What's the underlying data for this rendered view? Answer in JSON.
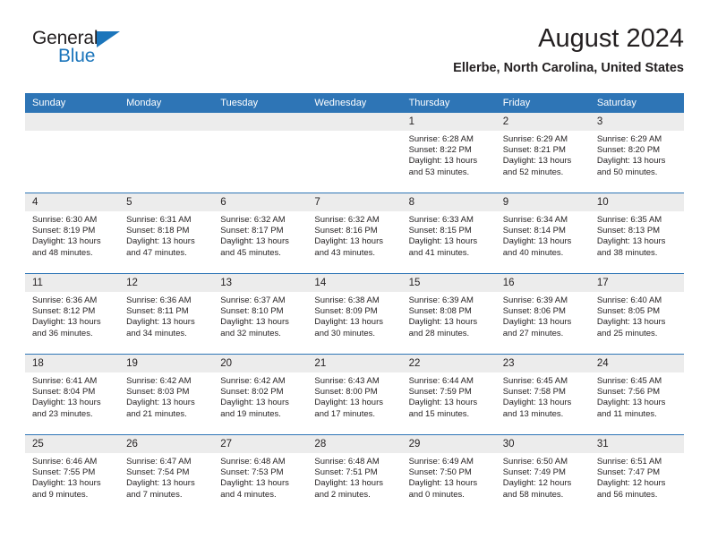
{
  "brand": {
    "name_part1": "General",
    "name_part2": "Blue",
    "accent_color": "#1b75bb"
  },
  "header": {
    "month_title": "August 2024",
    "location": "Ellerbe, North Carolina, United States"
  },
  "theme": {
    "header_blue": "#2e75b6",
    "daynum_background": "#ececec",
    "text_color": "#231f20"
  },
  "weekday_headers": [
    "Sunday",
    "Monday",
    "Tuesday",
    "Wednesday",
    "Thursday",
    "Friday",
    "Saturday"
  ],
  "weeks": [
    [
      {
        "day": "",
        "empty": true,
        "sunrise": "",
        "sunset": "",
        "daylight_line1": "",
        "daylight_line2": ""
      },
      {
        "day": "",
        "empty": true,
        "sunrise": "",
        "sunset": "",
        "daylight_line1": "",
        "daylight_line2": ""
      },
      {
        "day": "",
        "empty": true,
        "sunrise": "",
        "sunset": "",
        "daylight_line1": "",
        "daylight_line2": ""
      },
      {
        "day": "",
        "empty": true,
        "sunrise": "",
        "sunset": "",
        "daylight_line1": "",
        "daylight_line2": ""
      },
      {
        "day": "1",
        "empty": false,
        "sunrise": "Sunrise: 6:28 AM",
        "sunset": "Sunset: 8:22 PM",
        "daylight_line1": "Daylight: 13 hours",
        "daylight_line2": "and 53 minutes."
      },
      {
        "day": "2",
        "empty": false,
        "sunrise": "Sunrise: 6:29 AM",
        "sunset": "Sunset: 8:21 PM",
        "daylight_line1": "Daylight: 13 hours",
        "daylight_line2": "and 52 minutes."
      },
      {
        "day": "3",
        "empty": false,
        "sunrise": "Sunrise: 6:29 AM",
        "sunset": "Sunset: 8:20 PM",
        "daylight_line1": "Daylight: 13 hours",
        "daylight_line2": "and 50 minutes."
      }
    ],
    [
      {
        "day": "4",
        "empty": false,
        "sunrise": "Sunrise: 6:30 AM",
        "sunset": "Sunset: 8:19 PM",
        "daylight_line1": "Daylight: 13 hours",
        "daylight_line2": "and 48 minutes."
      },
      {
        "day": "5",
        "empty": false,
        "sunrise": "Sunrise: 6:31 AM",
        "sunset": "Sunset: 8:18 PM",
        "daylight_line1": "Daylight: 13 hours",
        "daylight_line2": "and 47 minutes."
      },
      {
        "day": "6",
        "empty": false,
        "sunrise": "Sunrise: 6:32 AM",
        "sunset": "Sunset: 8:17 PM",
        "daylight_line1": "Daylight: 13 hours",
        "daylight_line2": "and 45 minutes."
      },
      {
        "day": "7",
        "empty": false,
        "sunrise": "Sunrise: 6:32 AM",
        "sunset": "Sunset: 8:16 PM",
        "daylight_line1": "Daylight: 13 hours",
        "daylight_line2": "and 43 minutes."
      },
      {
        "day": "8",
        "empty": false,
        "sunrise": "Sunrise: 6:33 AM",
        "sunset": "Sunset: 8:15 PM",
        "daylight_line1": "Daylight: 13 hours",
        "daylight_line2": "and 41 minutes."
      },
      {
        "day": "9",
        "empty": false,
        "sunrise": "Sunrise: 6:34 AM",
        "sunset": "Sunset: 8:14 PM",
        "daylight_line1": "Daylight: 13 hours",
        "daylight_line2": "and 40 minutes."
      },
      {
        "day": "10",
        "empty": false,
        "sunrise": "Sunrise: 6:35 AM",
        "sunset": "Sunset: 8:13 PM",
        "daylight_line1": "Daylight: 13 hours",
        "daylight_line2": "and 38 minutes."
      }
    ],
    [
      {
        "day": "11",
        "empty": false,
        "sunrise": "Sunrise: 6:36 AM",
        "sunset": "Sunset: 8:12 PM",
        "daylight_line1": "Daylight: 13 hours",
        "daylight_line2": "and 36 minutes."
      },
      {
        "day": "12",
        "empty": false,
        "sunrise": "Sunrise: 6:36 AM",
        "sunset": "Sunset: 8:11 PM",
        "daylight_line1": "Daylight: 13 hours",
        "daylight_line2": "and 34 minutes."
      },
      {
        "day": "13",
        "empty": false,
        "sunrise": "Sunrise: 6:37 AM",
        "sunset": "Sunset: 8:10 PM",
        "daylight_line1": "Daylight: 13 hours",
        "daylight_line2": "and 32 minutes."
      },
      {
        "day": "14",
        "empty": false,
        "sunrise": "Sunrise: 6:38 AM",
        "sunset": "Sunset: 8:09 PM",
        "daylight_line1": "Daylight: 13 hours",
        "daylight_line2": "and 30 minutes."
      },
      {
        "day": "15",
        "empty": false,
        "sunrise": "Sunrise: 6:39 AM",
        "sunset": "Sunset: 8:08 PM",
        "daylight_line1": "Daylight: 13 hours",
        "daylight_line2": "and 28 minutes."
      },
      {
        "day": "16",
        "empty": false,
        "sunrise": "Sunrise: 6:39 AM",
        "sunset": "Sunset: 8:06 PM",
        "daylight_line1": "Daylight: 13 hours",
        "daylight_line2": "and 27 minutes."
      },
      {
        "day": "17",
        "empty": false,
        "sunrise": "Sunrise: 6:40 AM",
        "sunset": "Sunset: 8:05 PM",
        "daylight_line1": "Daylight: 13 hours",
        "daylight_line2": "and 25 minutes."
      }
    ],
    [
      {
        "day": "18",
        "empty": false,
        "sunrise": "Sunrise: 6:41 AM",
        "sunset": "Sunset: 8:04 PM",
        "daylight_line1": "Daylight: 13 hours",
        "daylight_line2": "and 23 minutes."
      },
      {
        "day": "19",
        "empty": false,
        "sunrise": "Sunrise: 6:42 AM",
        "sunset": "Sunset: 8:03 PM",
        "daylight_line1": "Daylight: 13 hours",
        "daylight_line2": "and 21 minutes."
      },
      {
        "day": "20",
        "empty": false,
        "sunrise": "Sunrise: 6:42 AM",
        "sunset": "Sunset: 8:02 PM",
        "daylight_line1": "Daylight: 13 hours",
        "daylight_line2": "and 19 minutes."
      },
      {
        "day": "21",
        "empty": false,
        "sunrise": "Sunrise: 6:43 AM",
        "sunset": "Sunset: 8:00 PM",
        "daylight_line1": "Daylight: 13 hours",
        "daylight_line2": "and 17 minutes."
      },
      {
        "day": "22",
        "empty": false,
        "sunrise": "Sunrise: 6:44 AM",
        "sunset": "Sunset: 7:59 PM",
        "daylight_line1": "Daylight: 13 hours",
        "daylight_line2": "and 15 minutes."
      },
      {
        "day": "23",
        "empty": false,
        "sunrise": "Sunrise: 6:45 AM",
        "sunset": "Sunset: 7:58 PM",
        "daylight_line1": "Daylight: 13 hours",
        "daylight_line2": "and 13 minutes."
      },
      {
        "day": "24",
        "empty": false,
        "sunrise": "Sunrise: 6:45 AM",
        "sunset": "Sunset: 7:56 PM",
        "daylight_line1": "Daylight: 13 hours",
        "daylight_line2": "and 11 minutes."
      }
    ],
    [
      {
        "day": "25",
        "empty": false,
        "sunrise": "Sunrise: 6:46 AM",
        "sunset": "Sunset: 7:55 PM",
        "daylight_line1": "Daylight: 13 hours",
        "daylight_line2": "and 9 minutes."
      },
      {
        "day": "26",
        "empty": false,
        "sunrise": "Sunrise: 6:47 AM",
        "sunset": "Sunset: 7:54 PM",
        "daylight_line1": "Daylight: 13 hours",
        "daylight_line2": "and 7 minutes."
      },
      {
        "day": "27",
        "empty": false,
        "sunrise": "Sunrise: 6:48 AM",
        "sunset": "Sunset: 7:53 PM",
        "daylight_line1": "Daylight: 13 hours",
        "daylight_line2": "and 4 minutes."
      },
      {
        "day": "28",
        "empty": false,
        "sunrise": "Sunrise: 6:48 AM",
        "sunset": "Sunset: 7:51 PM",
        "daylight_line1": "Daylight: 13 hours",
        "daylight_line2": "and 2 minutes."
      },
      {
        "day": "29",
        "empty": false,
        "sunrise": "Sunrise: 6:49 AM",
        "sunset": "Sunset: 7:50 PM",
        "daylight_line1": "Daylight: 13 hours",
        "daylight_line2": "and 0 minutes."
      },
      {
        "day": "30",
        "empty": false,
        "sunrise": "Sunrise: 6:50 AM",
        "sunset": "Sunset: 7:49 PM",
        "daylight_line1": "Daylight: 12 hours",
        "daylight_line2": "and 58 minutes."
      },
      {
        "day": "31",
        "empty": false,
        "sunrise": "Sunrise: 6:51 AM",
        "sunset": "Sunset: 7:47 PM",
        "daylight_line1": "Daylight: 12 hours",
        "daylight_line2": "and 56 minutes."
      }
    ]
  ]
}
